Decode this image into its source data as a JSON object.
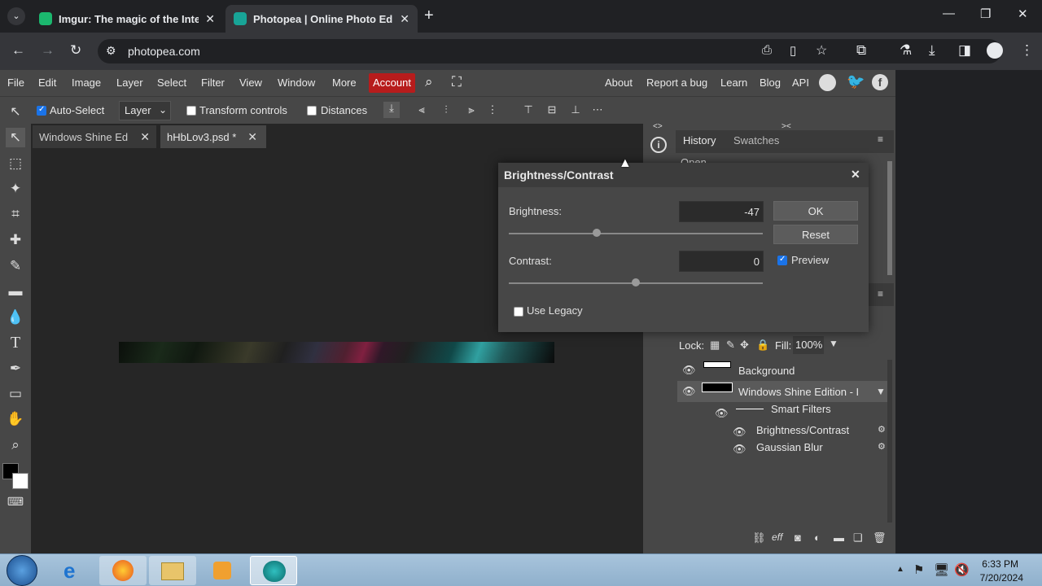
{
  "browser": {
    "tabs": [
      {
        "title": "Imgur: The magic of the Intern",
        "favicon_color": "#1bb76e"
      },
      {
        "title": "Photopea | Online Photo Editor",
        "favicon_color": "#18a497"
      }
    ],
    "url": "photopea.com"
  },
  "menu": {
    "items": [
      "File",
      "Edit",
      "Image",
      "Layer",
      "Select",
      "Filter",
      "View",
      "Window",
      "More"
    ],
    "account": "Account",
    "right_items": [
      "About",
      "Report a bug",
      "Learn",
      "Blog",
      "API"
    ]
  },
  "options": {
    "auto_select": "Auto-Select",
    "layer_select": "Layer",
    "transform_controls": "Transform controls",
    "distances": "Distances"
  },
  "documents": {
    "tabs": [
      "Windows Shine Ed:",
      "hHbLov3.psd *"
    ]
  },
  "panels": {
    "history_tab": "History",
    "swatches_tab": "Swatches",
    "history_first": "Open",
    "lock_label": "Lock:",
    "fill_label": "Fill:",
    "fill_value": "100%"
  },
  "layers": {
    "background": "Background",
    "layer_name": "Windows Shine Edition - I",
    "smart_filters": "Smart Filters",
    "filter1": "Brightness/Contrast",
    "filter2": "Gaussian Blur"
  },
  "dialog": {
    "title": "Brightness/Contrast",
    "brightness_label": "Brightness:",
    "brightness_value": "-47",
    "contrast_label": "Contrast:",
    "contrast_value": "0",
    "ok": "OK",
    "reset": "Reset",
    "preview": "Preview",
    "use_legacy": "Use Legacy"
  },
  "taskbar": {
    "time": "6:33 PM",
    "date": "7/20/2024"
  },
  "colors": {
    "accent": "#b71c1c",
    "panel": "#474747",
    "workspace": "#262626"
  }
}
